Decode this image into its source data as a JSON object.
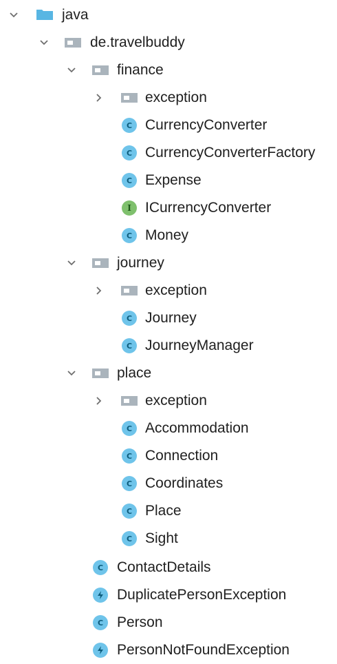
{
  "tree": {
    "root": {
      "label": "java",
      "icon": "source-folder-icon",
      "expanded": true
    },
    "package": {
      "label": "de.travelbuddy",
      "icon": "package-icon",
      "expanded": true
    },
    "finance": {
      "label": "finance",
      "expanded": true,
      "exception_folder": "exception",
      "items": [
        "CurrencyConverter",
        "CurrencyConverterFactory",
        "Expense",
        "ICurrencyConverter",
        "Money"
      ]
    },
    "journey": {
      "label": "journey",
      "expanded": true,
      "exception_folder": "exception",
      "items": [
        "Journey",
        "JourneyManager"
      ]
    },
    "place": {
      "label": "place",
      "expanded": true,
      "exception_folder": "exception",
      "items": [
        "Accommodation",
        "Connection",
        "Coordinates",
        "Place",
        "Sight"
      ]
    },
    "top_items": [
      "ContactDetails",
      "DuplicatePersonException",
      "Person",
      "PersonNotFoundException"
    ]
  },
  "badges": {
    "class": "C",
    "interface": "I"
  },
  "colors": {
    "class_badge": "#6fc4ea",
    "interface_badge": "#7fc06d",
    "source_folder": "#58b6e3",
    "package_folder": "#aab4bc",
    "arrow": "#6e6e6e"
  }
}
